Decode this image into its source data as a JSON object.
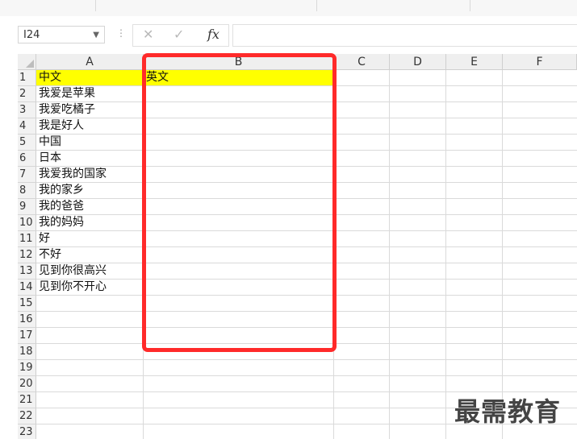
{
  "name_box": {
    "value": "I24"
  },
  "formula_bar": {
    "cancel_icon": "✕",
    "enter_icon": "✓",
    "fx_label": "fx",
    "value": ""
  },
  "columns": [
    "A",
    "B",
    "C",
    "D",
    "E",
    "F"
  ],
  "rows": [
    {
      "num": "1",
      "a": "中文",
      "b": "英文"
    },
    {
      "num": "2",
      "a": "我爱是苹果",
      "b": ""
    },
    {
      "num": "3",
      "a": "我爱吃橘子",
      "b": ""
    },
    {
      "num": "4",
      "a": "我是好人",
      "b": ""
    },
    {
      "num": "5",
      "a": "中国",
      "b": ""
    },
    {
      "num": "6",
      "a": "日本",
      "b": ""
    },
    {
      "num": "7",
      "a": "我爱我的国家",
      "b": ""
    },
    {
      "num": "8",
      "a": "我的家乡",
      "b": ""
    },
    {
      "num": "9",
      "a": "我的爸爸",
      "b": ""
    },
    {
      "num": "10",
      "a": "我的妈妈",
      "b": ""
    },
    {
      "num": "11",
      "a": "好",
      "b": ""
    },
    {
      "num": "12",
      "a": "不好",
      "b": ""
    },
    {
      "num": "13",
      "a": "见到你很高兴",
      "b": ""
    },
    {
      "num": "14",
      "a": "见到你不开心",
      "b": ""
    },
    {
      "num": "15",
      "a": "",
      "b": ""
    },
    {
      "num": "16",
      "a": "",
      "b": ""
    },
    {
      "num": "17",
      "a": "",
      "b": ""
    },
    {
      "num": "18",
      "a": "",
      "b": ""
    },
    {
      "num": "19",
      "a": "",
      "b": ""
    },
    {
      "num": "20",
      "a": "",
      "b": ""
    },
    {
      "num": "21",
      "a": "",
      "b": ""
    },
    {
      "num": "22",
      "a": "",
      "b": ""
    },
    {
      "num": "23",
      "a": "",
      "b": ""
    }
  ],
  "header_fill": "#ffff00",
  "highlight_color": "#ff2a2a",
  "watermark": "最需教育"
}
